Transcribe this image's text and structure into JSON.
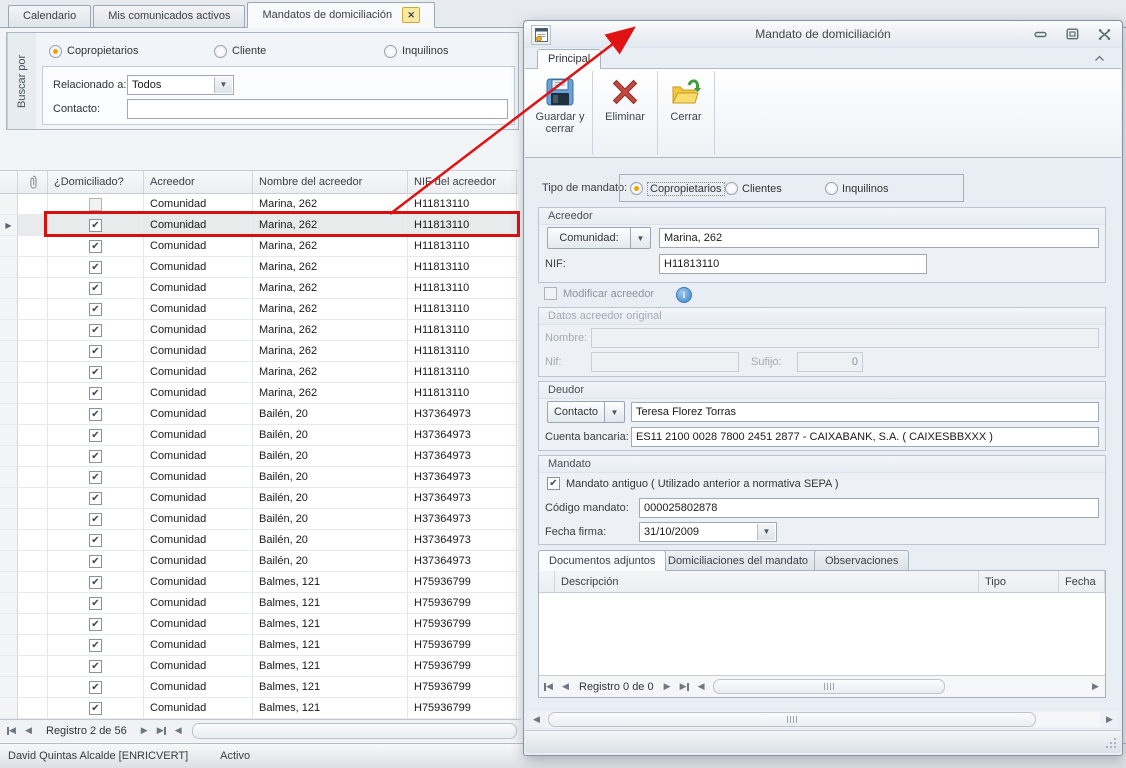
{
  "colors": {
    "highlight_red": "#d80f0f",
    "radio_selected_orange": "#f0a200",
    "tab_close_yellow": "#fbe9a0",
    "info_blue": "#4a90d2",
    "save_icon_blue": "#6aa1d8",
    "delete_icon_red": "#c5473f",
    "folder_icon_yellow": "#f5c73d",
    "folder_arrow_green": "#3f9d3f"
  },
  "main_window": {
    "tabs": [
      {
        "label": "Calendario"
      },
      {
        "label": "Mis comunicados activos"
      },
      {
        "label": "Mandatos de domiciliación",
        "active": true,
        "close_icon": "close-icon"
      }
    ],
    "search_panel": {
      "side_label": "Buscar por",
      "radios": [
        {
          "label": "Copropietarios",
          "selected": true
        },
        {
          "label": "Cliente",
          "selected": false
        },
        {
          "label": "Inquilinos",
          "selected": false
        }
      ],
      "relacionado_label": "Relacionado a:",
      "relacionado_value": "Todos",
      "contacto_label": "Contacto:",
      "contacto_value": ""
    },
    "grid": {
      "columns": [
        "",
        "paperclip-icon",
        "¿Domiciliado?",
        "Acreedor",
        "Nombre del acreedor",
        "NIF del acreedor"
      ],
      "selected_index": 1,
      "rows": [
        {
          "domiciliado": false,
          "acreedor": "Comunidad",
          "nombre": "Marina, 262",
          "nif": "H11813110"
        },
        {
          "domiciliado": true,
          "acreedor": "Comunidad",
          "nombre": "Marina, 262",
          "nif": "H11813110"
        },
        {
          "domiciliado": true,
          "acreedor": "Comunidad",
          "nombre": "Marina, 262",
          "nif": "H11813110"
        },
        {
          "domiciliado": true,
          "acreedor": "Comunidad",
          "nombre": "Marina, 262",
          "nif": "H11813110"
        },
        {
          "domiciliado": true,
          "acreedor": "Comunidad",
          "nombre": "Marina, 262",
          "nif": "H11813110"
        },
        {
          "domiciliado": true,
          "acreedor": "Comunidad",
          "nombre": "Marina, 262",
          "nif": "H11813110"
        },
        {
          "domiciliado": true,
          "acreedor": "Comunidad",
          "nombre": "Marina, 262",
          "nif": "H11813110"
        },
        {
          "domiciliado": true,
          "acreedor": "Comunidad",
          "nombre": "Marina, 262",
          "nif": "H11813110"
        },
        {
          "domiciliado": true,
          "acreedor": "Comunidad",
          "nombre": "Marina, 262",
          "nif": "H11813110"
        },
        {
          "domiciliado": true,
          "acreedor": "Comunidad",
          "nombre": "Marina, 262",
          "nif": "H11813110"
        },
        {
          "domiciliado": true,
          "acreedor": "Comunidad",
          "nombre": "Bailén, 20",
          "nif": "H37364973"
        },
        {
          "domiciliado": true,
          "acreedor": "Comunidad",
          "nombre": "Bailén, 20",
          "nif": "H37364973"
        },
        {
          "domiciliado": true,
          "acreedor": "Comunidad",
          "nombre": "Bailén, 20",
          "nif": "H37364973"
        },
        {
          "domiciliado": true,
          "acreedor": "Comunidad",
          "nombre": "Bailén, 20",
          "nif": "H37364973"
        },
        {
          "domiciliado": true,
          "acreedor": "Comunidad",
          "nombre": "Bailén, 20",
          "nif": "H37364973"
        },
        {
          "domiciliado": true,
          "acreedor": "Comunidad",
          "nombre": "Bailén, 20",
          "nif": "H37364973"
        },
        {
          "domiciliado": true,
          "acreedor": "Comunidad",
          "nombre": "Bailén, 20",
          "nif": "H37364973"
        },
        {
          "domiciliado": true,
          "acreedor": "Comunidad",
          "nombre": "Bailén, 20",
          "nif": "H37364973"
        },
        {
          "domiciliado": true,
          "acreedor": "Comunidad",
          "nombre": "Balmes, 121",
          "nif": "H75936799"
        },
        {
          "domiciliado": true,
          "acreedor": "Comunidad",
          "nombre": "Balmes, 121",
          "nif": "H75936799"
        },
        {
          "domiciliado": true,
          "acreedor": "Comunidad",
          "nombre": "Balmes, 121",
          "nif": "H75936799"
        },
        {
          "domiciliado": true,
          "acreedor": "Comunidad",
          "nombre": "Balmes, 121",
          "nif": "H75936799"
        },
        {
          "domiciliado": true,
          "acreedor": "Comunidad",
          "nombre": "Balmes, 121",
          "nif": "H75936799"
        },
        {
          "domiciliado": true,
          "acreedor": "Comunidad",
          "nombre": "Balmes, 121",
          "nif": "H75936799"
        },
        {
          "domiciliado": true,
          "acreedor": "Comunidad",
          "nombre": "Balmes, 121",
          "nif": "H75936799"
        }
      ]
    },
    "record_nav": {
      "label": "Registro 2 de 56"
    },
    "status_bar": {
      "user": "David Quintas Alcalde [ENRICVERT]",
      "state": "Activo"
    }
  },
  "dialog": {
    "title": "Mandato de domiciliación",
    "main_tab": "Principal",
    "toolbar": [
      {
        "label": "Guardar y cerrar",
        "icon": "save-icon"
      },
      {
        "label": "Eliminar",
        "icon": "delete-icon"
      },
      {
        "label": "Cerrar",
        "icon": "close-folder-icon"
      }
    ],
    "tipo_mandato": {
      "label": "Tipo de mandato:",
      "options": [
        {
          "label": "Copropietarios",
          "selected": true
        },
        {
          "label": "Clientes",
          "selected": false
        },
        {
          "label": "Inquilinos",
          "selected": false
        }
      ]
    },
    "acreedor": {
      "caption": "Acreedor",
      "tipo_button": "Comunidad:",
      "nombre": "Marina, 262",
      "nif_label": "NIF:",
      "nif": "H11813110"
    },
    "modificar_acreedor": {
      "label": "Modificar acreedor",
      "checked": false
    },
    "datos_acreedor_original": {
      "caption": "Datos acreedor original",
      "nombre_label": "Nombre:",
      "nombre": "",
      "nif_label": "Nif:",
      "nif": "",
      "sufijo_label": "Sufijo:",
      "sufijo": "0"
    },
    "deudor": {
      "caption": "Deudor",
      "tipo_button": "Contacto",
      "nombre": "Teresa Florez Torras",
      "cuenta_label": "Cuenta bancaria:",
      "cuenta": "ES11 2100 0028 7800 2451 2877 - CAIXABANK, S.A. ( CAIXESBBXXX )"
    },
    "mandato": {
      "caption": "Mandato",
      "antiguo_label": "Mandato antiguo ( Utilizado anterior a normativa SEPA )",
      "antiguo_checked": true,
      "codigo_label": "Código mandato:",
      "codigo": "000025802878",
      "fecha_label": "Fecha firma:",
      "fecha": "31/10/2009"
    },
    "bottom_tabs": [
      {
        "label": "Documentos adjuntos",
        "active": true
      },
      {
        "label": "Domiciliaciones del mandato",
        "active": false
      },
      {
        "label": "Observaciones",
        "active": false
      }
    ],
    "doc_grid": {
      "columns": [
        "Descripción",
        "Tipo",
        "Fecha"
      ],
      "rows": []
    },
    "record_nav": {
      "label": "Registro 0 de 0"
    }
  }
}
